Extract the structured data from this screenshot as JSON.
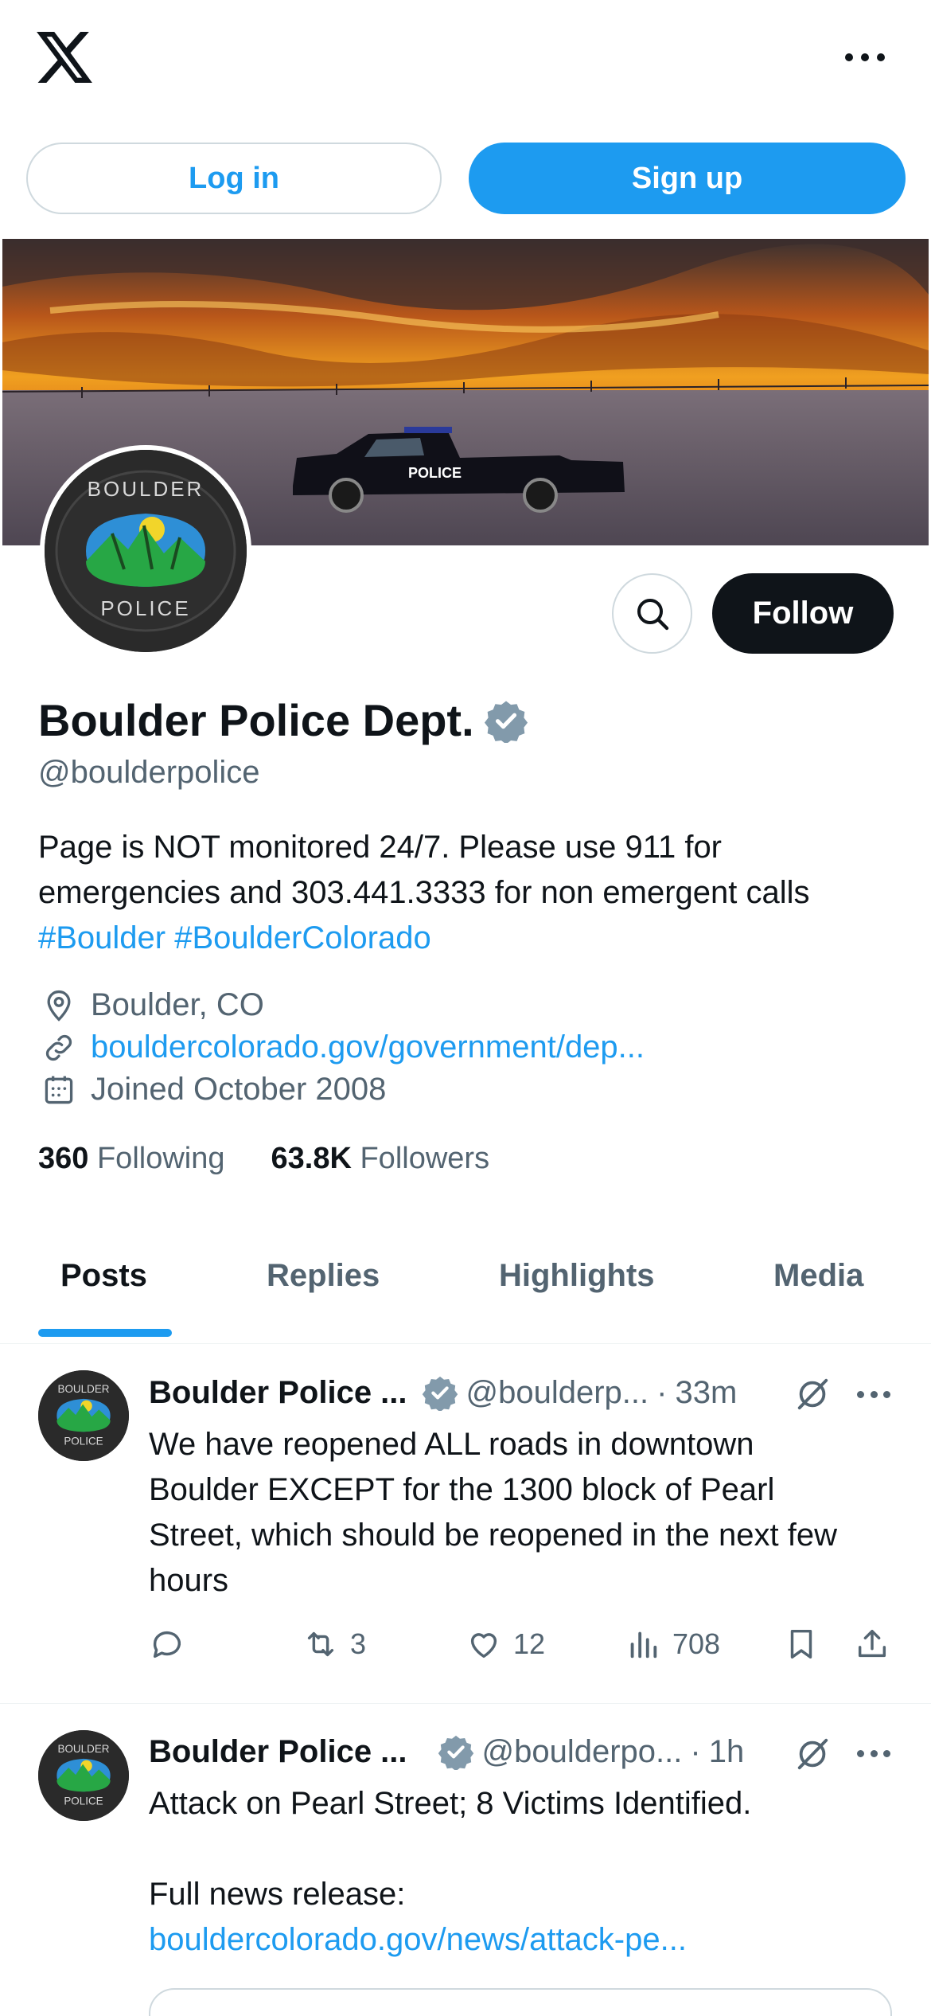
{
  "topbar": {
    "logo_icon": "x-logo-icon",
    "more_icon": "more-dots-icon"
  },
  "auth": {
    "login_label": "Log in",
    "signup_label": "Sign up"
  },
  "profile": {
    "display_name": "Boulder Police Dept.",
    "handle": "@boulderpolice",
    "follow_label": "Follow",
    "bio_text": "Page is NOT monitored 24/7. Please use 911 for emergencies and 303.441.3333 for non emergent calls",
    "bio_tags": [
      "#Boulder",
      "#BoulderColorado"
    ],
    "avatar_logo_text_top": "BOULDER",
    "avatar_logo_text_bottom": "POLICE",
    "banner_vehicle_text": "POLICE",
    "location": "Boulder, CO",
    "website": "bouldercolorado.gov/government/dep...",
    "joined": "Joined October 2008",
    "following_count": "360",
    "following_label": "Following",
    "followers_count": "63.8K",
    "followers_label": "Followers"
  },
  "tabs": [
    {
      "label": "Posts",
      "active": true
    },
    {
      "label": "Replies",
      "active": false
    },
    {
      "label": "Highlights",
      "active": false
    },
    {
      "label": "Media",
      "active": false
    }
  ],
  "posts": [
    {
      "name": "Boulder Police ...",
      "handle": "@boulderp...",
      "separator": "·",
      "time": "33m",
      "text": "We have reopened ALL roads in downtown Boulder EXCEPT for the 1300 block of Pearl Street, which should be reopened in the next few hours",
      "replies": "",
      "reposts": "3",
      "likes": "12",
      "views": "708"
    },
    {
      "name": "Boulder Police ...",
      "handle": "@boulderpo...",
      "separator": "·",
      "time": "1h",
      "text": "Attack on Pearl Street; 8 Victims Identified.",
      "text2": "Full news release:",
      "link": "bouldercolorado.gov/news/attack-pe..."
    }
  ],
  "colors": {
    "accent": "#1d9bf0",
    "text_primary": "#0f1419",
    "text_secondary": "#536471",
    "border": "#cfd9de"
  }
}
